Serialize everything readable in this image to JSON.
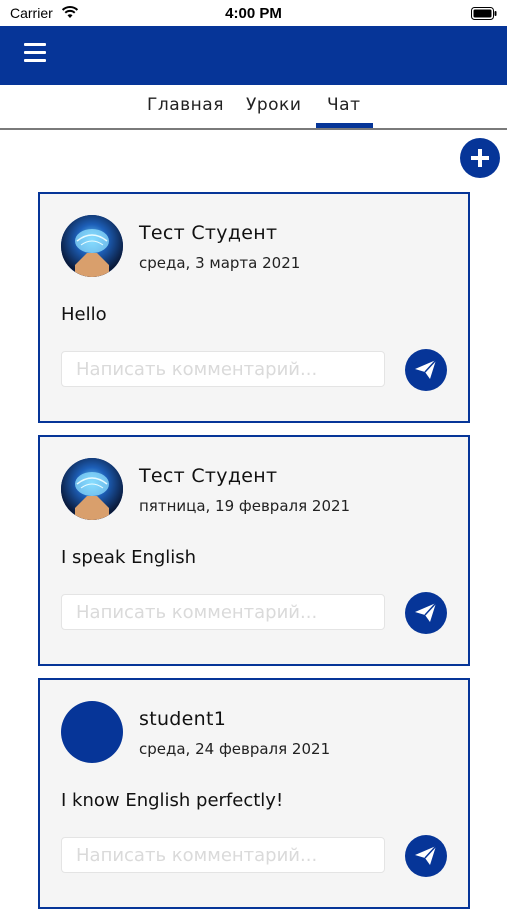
{
  "status_bar": {
    "carrier": "Carrier",
    "time": "4:00 PM"
  },
  "tabs": [
    {
      "label": "Главная",
      "active": false
    },
    {
      "label": "Уроки",
      "active": false
    },
    {
      "label": "Чат",
      "active": true
    }
  ],
  "colors": {
    "brand": "#063598",
    "card_bg": "#f5f5f5"
  },
  "posts": [
    {
      "author": "Тест Студент",
      "date": "среда, 3 марта 2021",
      "message": "Hello",
      "avatar": "brain-image",
      "comment_placeholder": "Написать комментарий..."
    },
    {
      "author": "Тест Студент",
      "date": "пятница, 19 февраля 2021",
      "message": "I speak English",
      "avatar": "brain-image",
      "comment_placeholder": "Написать комментарий..."
    },
    {
      "author": "student1",
      "date": "среда, 24 февраля 2021",
      "message": "I know English perfectly!",
      "avatar": "blank",
      "comment_placeholder": "Написать комментарий..."
    }
  ]
}
